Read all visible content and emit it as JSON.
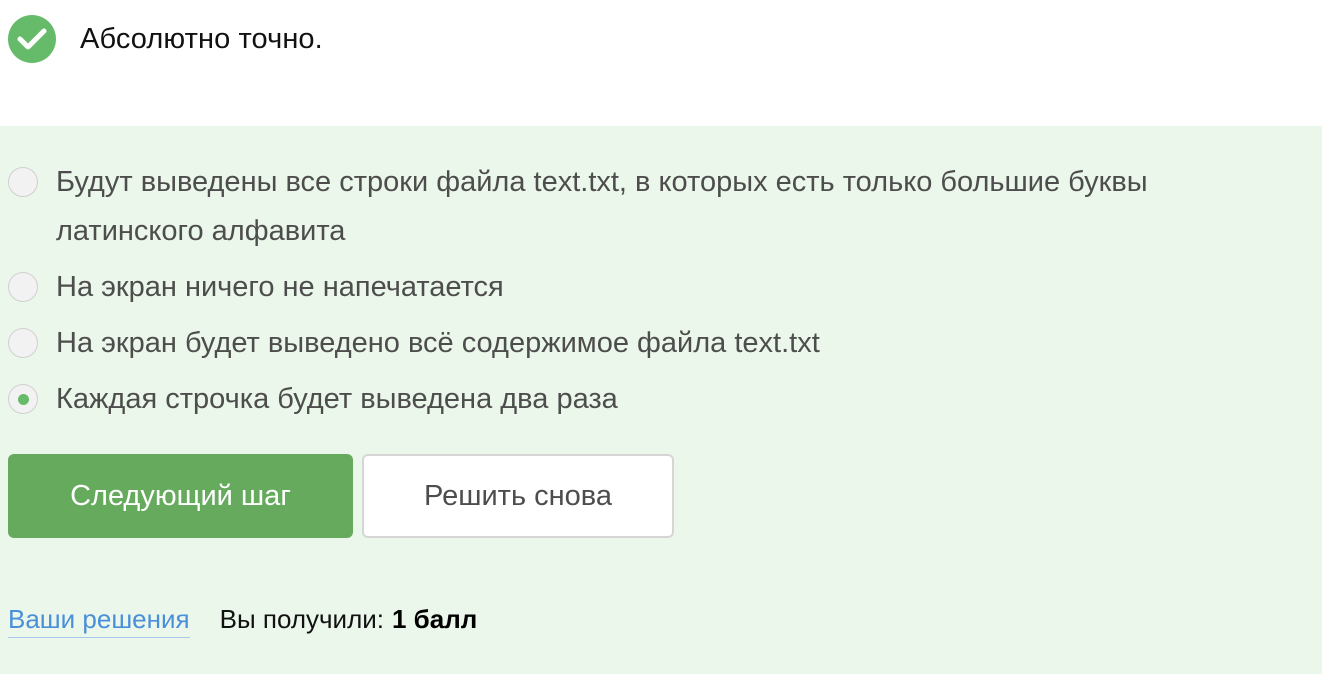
{
  "result": {
    "icon": "checkmark-icon",
    "text": "Абсолютно точно.",
    "accent_color": "#66bb6a"
  },
  "quiz": {
    "options": [
      {
        "label": "Будут выведены все строки файла text.txt, в которых есть только большие буквы латинского алфавита",
        "selected": false
      },
      {
        "label": "На экран ничего не напечатается",
        "selected": false
      },
      {
        "label": "На экран будет выведено всё содержимое файла text.txt",
        "selected": false
      },
      {
        "label": "Каждая строчка будет выведена два раза",
        "selected": true
      }
    ],
    "panel_color": "#ebf7ea"
  },
  "actions": {
    "next_label": "Следующий шаг",
    "retry_label": "Решить снова",
    "primary_color": "#66aa5e"
  },
  "footer": {
    "solutions_link": "Ваши решения",
    "score_label": "Вы получили:",
    "score_value": "1 балл"
  }
}
